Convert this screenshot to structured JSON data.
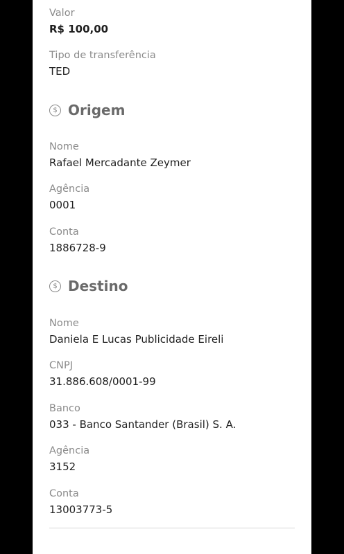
{
  "transfer": {
    "valor_label": "Valor",
    "valor_value": "R$ 100,00",
    "tipo_label": "Tipo de transferência",
    "tipo_value": "TED"
  },
  "origem": {
    "title": "Origem",
    "icon": "dollar-coin-icon",
    "nome_label": "Nome",
    "nome_value": "Rafael Mercadante Zeymer",
    "agencia_label": "Agência",
    "agencia_value": "0001",
    "conta_label": "Conta",
    "conta_value": "1886728-9"
  },
  "destino": {
    "title": "Destino",
    "icon": "dollar-coin-icon",
    "nome_label": "Nome",
    "nome_value": "Daniela E Lucas Publicidade Eireli",
    "cnpj_label": "CNPJ",
    "cnpj_value": "31.886.608/0001-99",
    "banco_label": "Banco",
    "banco_value": "033 - Banco Santander (Brasil) S. A.",
    "agencia_label": "Agência",
    "agencia_value": "3152",
    "conta_label": "Conta",
    "conta_value": "13003773-5"
  },
  "icons": {
    "coin_glyph": "$"
  },
  "colors": {
    "background": "#000000",
    "panel": "#ffffff",
    "label": "#8a8a8a",
    "value": "#1f1f1f",
    "section_title": "#6a6a6a"
  }
}
